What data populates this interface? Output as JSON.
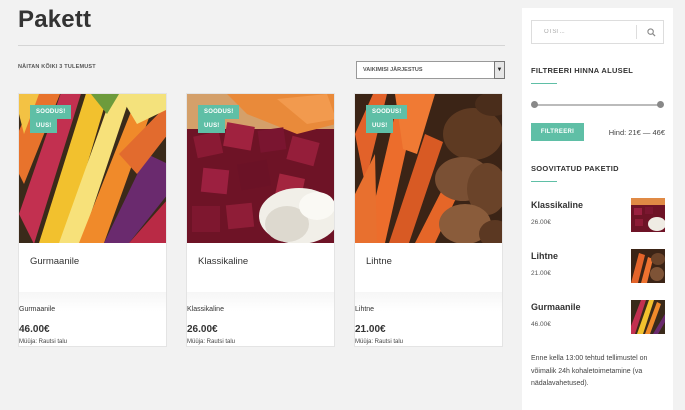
{
  "page": {
    "title": "Pakett"
  },
  "toolbar": {
    "result_count": "NÄITAN KÕIKI 3 TULEMUST",
    "sort_selected": "VAIKIMISI JÄRJESTUS"
  },
  "products": [
    {
      "name": "Gurmaanile",
      "name_small": "Gurmaanile",
      "price": "46.00€",
      "vendor": "Müüja: Rautsi talu",
      "badge_sale": "SOODUS!",
      "badge_new": "UUS!",
      "image_icon": "rainbow-carrots"
    },
    {
      "name": "Klassikaline",
      "name_small": "Klassikaline",
      "price": "26.00€",
      "vendor": "Müüja: Rautsi talu",
      "badge_sale": "SOODUS!",
      "badge_new": "UUS!",
      "image_icon": "diced-beets"
    },
    {
      "name": "Lihtne",
      "name_small": "Lihtne",
      "price": "21.00€",
      "vendor": "Müüja: Rautsi talu",
      "badge_sale": "SOODUS!",
      "badge_new": "UUS!",
      "image_icon": "carrots-potatoes"
    }
  ],
  "sidebar": {
    "search_placeholder": "OTSI ...",
    "filter_title": "FILTREERI HINNA ALUSEL",
    "filter_button": "FILTREERI",
    "price_range": "Hind: 21€ — 46€",
    "recommended_title": "SOOVITATUD PAKETID",
    "recommended": [
      {
        "name": "Klassikaline",
        "price": "26.00€"
      },
      {
        "name": "Lihtne",
        "price": "21.00€"
      },
      {
        "name": "Gurmaanile",
        "price": "46.00€"
      }
    ],
    "note": "Enne kella 13:00 tehtud tellimustel on võimalik 24h kohaletoimetamine (va nädalavahetused)."
  },
  "colors": {
    "accent": "#5fbfa6",
    "background": "#f2f2f2"
  }
}
